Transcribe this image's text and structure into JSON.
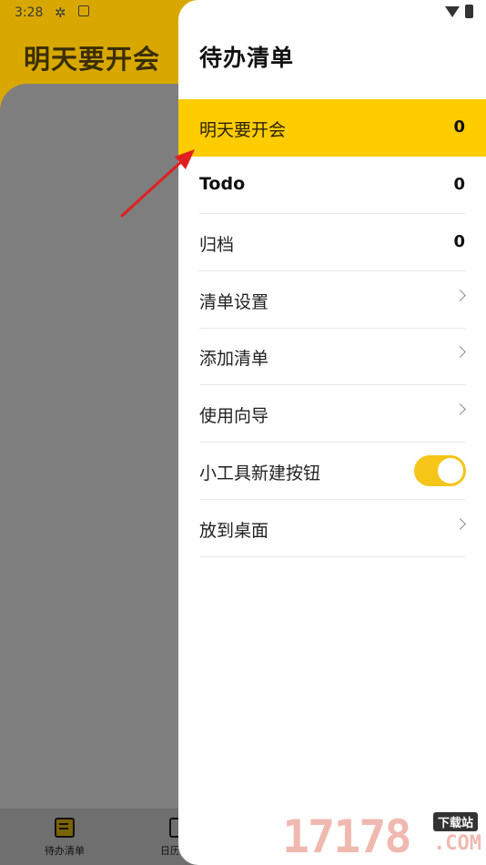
{
  "background_app": {
    "status_time": "3:28",
    "title": "明天要开会",
    "bottom_nav": [
      {
        "label": "待办清单"
      },
      {
        "label": "日历"
      }
    ]
  },
  "drawer": {
    "title": "待办清单",
    "items": [
      {
        "label": "明天要开会",
        "count": "0",
        "type": "list",
        "active": true
      },
      {
        "label": "Todo",
        "count": "0",
        "type": "list"
      },
      {
        "label": "归档",
        "count": "0",
        "type": "list"
      },
      {
        "label": "清单设置",
        "type": "nav"
      },
      {
        "label": "添加清单",
        "type": "nav"
      },
      {
        "label": "使用向导",
        "type": "nav"
      },
      {
        "label": "小工具新建按钮",
        "type": "toggle",
        "toggle_on": true
      },
      {
        "label": "放到桌面",
        "type": "nav"
      }
    ]
  },
  "colors": {
    "accent": "#ffcc00",
    "toggle_on": "#f5c518",
    "annotation_arrow": "#e02020"
  },
  "watermark": {
    "digits": "17178",
    "badge": "下载站",
    "suffix": ".COM"
  }
}
